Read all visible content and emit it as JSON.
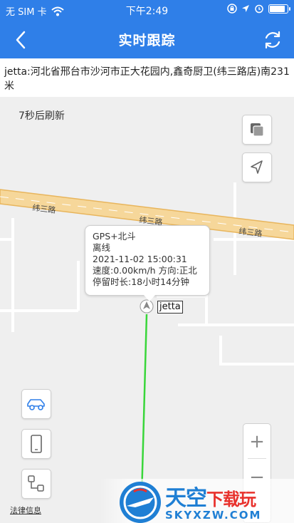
{
  "statusbar": {
    "carrier": "无 SIM 卡",
    "time": "下午2:49",
    "battery_level": 0.9
  },
  "navbar": {
    "title": "实时跟踪",
    "back_icon": "chevron-left-icon",
    "refresh_icon": "refresh-icon"
  },
  "address": "jetta:河北省邢台市沙河市正大花园内,鑫奇厨卫(纬三路店)南231米",
  "map": {
    "refresh_hint": "7秒后刷新",
    "road_labels": [
      "纬三路",
      "纬三路",
      "纬三路"
    ],
    "popup": {
      "line1": "GPS+北斗",
      "line2": "离线",
      "line3": "2021-11-02 15:00:31",
      "line4": "速度:0.00km/h 方向:正北",
      "line5": "停留时长:18小时14分钟"
    },
    "car_label": "jetta",
    "zoom_in": "+",
    "zoom_out": "−",
    "legal": "法律信息",
    "track_color": "#39d63a"
  },
  "watermark": {
    "title_main": "天空",
    "title_red": "下载玩",
    "subtitle": "SKYXZW.COM"
  }
}
